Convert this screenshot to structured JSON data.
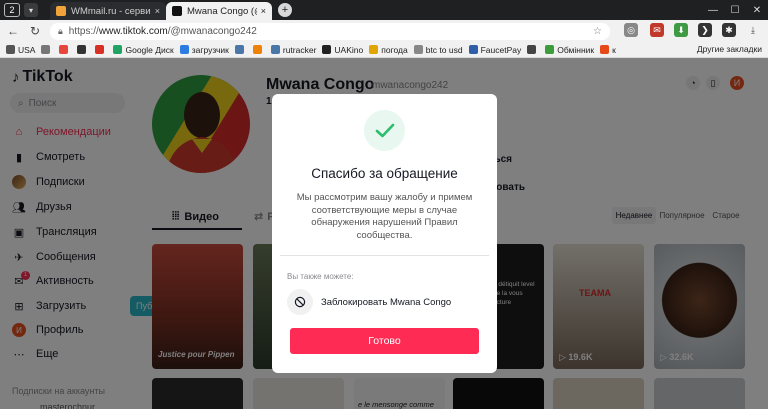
{
  "browser": {
    "tab_counter": "2",
    "tabs": [
      {
        "title": "WMmail.ru - сервис почт",
        "close": "×"
      },
      {
        "title": "Mwana Congo (@mwana",
        "close": "×"
      }
    ],
    "new_tab": "+",
    "window_controls": [
      "—",
      "☐",
      "✕"
    ],
    "url_scheme": "https://",
    "url_host": "www.tiktok.com",
    "url_path": "/@mwanacongo242",
    "bookmarks": [
      {
        "label": "USA",
        "color": "#555555"
      },
      {
        "label": "",
        "color": "#777777"
      },
      {
        "label": "",
        "color": "#e8453c"
      },
      {
        "label": "",
        "color": "#333333"
      },
      {
        "label": "",
        "color": "#d93025"
      },
      {
        "label": "Google Диск",
        "color": "#1fa463"
      },
      {
        "label": "загрузчик",
        "color": "#2b7de1"
      },
      {
        "label": "",
        "color": "#4a76a8"
      },
      {
        "label": "",
        "color": "#ee8208"
      },
      {
        "label": "rutracker",
        "color": "#4a76a8"
      },
      {
        "label": "UAKino",
        "color": "#222222"
      },
      {
        "label": "погода",
        "color": "#e0a500"
      },
      {
        "label": "btc to usd",
        "color": "#888888"
      },
      {
        "label": "FaucetPay",
        "color": "#2f5fa8"
      },
      {
        "label": "",
        "color": "#444444"
      },
      {
        "label": "Обмінник",
        "color": "#3b9d3b"
      },
      {
        "label": "к",
        "color": "#e64a19"
      }
    ],
    "bookmarks_other": "Другие закладки"
  },
  "tiktok": {
    "logo": "TikTok",
    "search_placeholder": "Поиск",
    "sidebar": [
      {
        "label": "Рекомендации",
        "icon": "home-icon"
      },
      {
        "label": "Смотреть",
        "icon": "watch-icon"
      },
      {
        "label": "Подписки",
        "icon": "following-icon"
      },
      {
        "label": "Друзья",
        "icon": "friends-icon"
      },
      {
        "label": "Трансляция",
        "icon": "live-icon"
      },
      {
        "label": "Сообщения",
        "icon": "messages-icon"
      },
      {
        "label": "Активность",
        "icon": "activity-icon",
        "badge": "1"
      },
      {
        "label": "Загрузить",
        "icon": "upload-icon"
      },
      {
        "label": "Профиль",
        "icon": "profile-icon",
        "avatar_letter": "И"
      },
      {
        "label": "Еще",
        "icon": "more-icon"
      }
    ],
    "tooltip": "Публикация видео",
    "accounts_heading": "Подписки на аккаунты",
    "accounts_first": "masterochnur",
    "profile": {
      "name": "Mwana Congo",
      "handle": "mwanacongo242",
      "stat_fragment": "16",
      "follow_fragment": "аться",
      "message_fragment": "ировать"
    },
    "user_avatar_letter": "И",
    "video_tab": "Видео",
    "reposts_fragment": "Ре",
    "sort_tabs": [
      "Недавнее",
      "Популярное",
      "Старое"
    ],
    "videos": [
      {
        "caption": "Justice pour Pippen",
        "views": ""
      },
      {
        "caption": "",
        "views": ""
      },
      {
        "caption": "",
        "views": ""
      },
      {
        "caption": "a détiquit level de la vous acture",
        "views": ""
      },
      {
        "caption": "TEAMA",
        "views": "19.6K"
      },
      {
        "caption": "",
        "views": "32.6K"
      }
    ],
    "second_row": [
      {
        "caption": ""
      },
      {
        "caption": ""
      },
      {
        "caption": "e le mensonge comme"
      },
      {
        "caption": ""
      },
      {
        "caption": ""
      },
      {
        "caption": ""
      }
    ]
  },
  "modal": {
    "title": "Спасибо за обращение",
    "description": "Мы рассмотрим вашу жалобу и примем соответствующие меры в случае обнаружения нарушений Правил сообщества.",
    "also_label": "Вы также можете:",
    "block_label": "Заблокировать Mwana Congo",
    "done_label": "Готово",
    "accent_color": "#fe2c55",
    "success_color": "#2dbd6e"
  }
}
